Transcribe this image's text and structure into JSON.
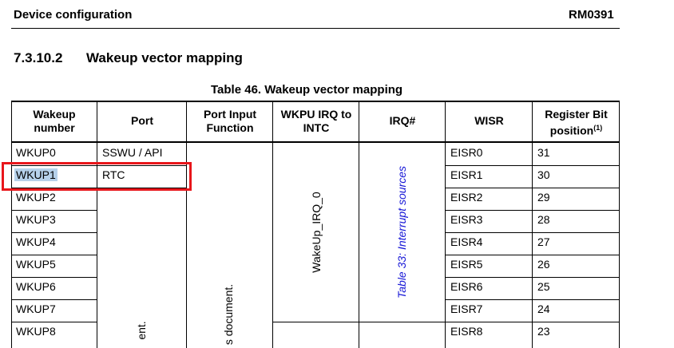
{
  "header": {
    "title": "Device configuration",
    "doc_id": "RM0391"
  },
  "section": {
    "number": "7.3.10.2",
    "title": "Wakeup vector mapping"
  },
  "table": {
    "caption": "Table 46. Wakeup vector mapping",
    "columns": {
      "wakeup_line1": "Wakeup",
      "wakeup_line2": "number",
      "port": "Port",
      "pif_line1": "Port Input",
      "pif_line2": "Function",
      "wkpu_line1": "WKPU IRQ to",
      "wkpu_line2": "INTC",
      "irq": "IRQ#",
      "wisr": "WISR",
      "regbit_line1": "Register Bit",
      "regbit_line2": "position",
      "regbit_note": "(1)"
    },
    "rows": [
      {
        "wakeup": "WKUP0",
        "port": "SSWU / API",
        "wisr": "EISR0",
        "bit": "31"
      },
      {
        "wakeup": "WKUP1",
        "port": "RTC",
        "wisr": "EISR1",
        "bit": "30"
      },
      {
        "wakeup": "WKUP2",
        "port": "",
        "wisr": "EISR2",
        "bit": "29"
      },
      {
        "wakeup": "WKUP3",
        "port": "",
        "wisr": "EISR3",
        "bit": "28"
      },
      {
        "wakeup": "WKUP4",
        "port": "",
        "wisr": "EISR4",
        "bit": "27"
      },
      {
        "wakeup": "WKUP5",
        "port": "",
        "wisr": "EISR5",
        "bit": "26"
      },
      {
        "wakeup": "WKUP6",
        "port": "",
        "wisr": "EISR6",
        "bit": "25"
      },
      {
        "wakeup": "WKUP7",
        "port": "",
        "wisr": "EISR7",
        "bit": "24"
      },
      {
        "wakeup": "WKUP8",
        "port": "",
        "wisr": "EISR8",
        "bit": "23"
      }
    ],
    "merged": {
      "wkpu_irq": "WakeUp_IRQ_0",
      "irq_ref": "Table 33: Interrupt sources",
      "port_fragment": "ent.",
      "pif_fragment": "s document."
    }
  },
  "highlight": {
    "color": "#e8161b",
    "selection_color": "#b6d1ea"
  }
}
